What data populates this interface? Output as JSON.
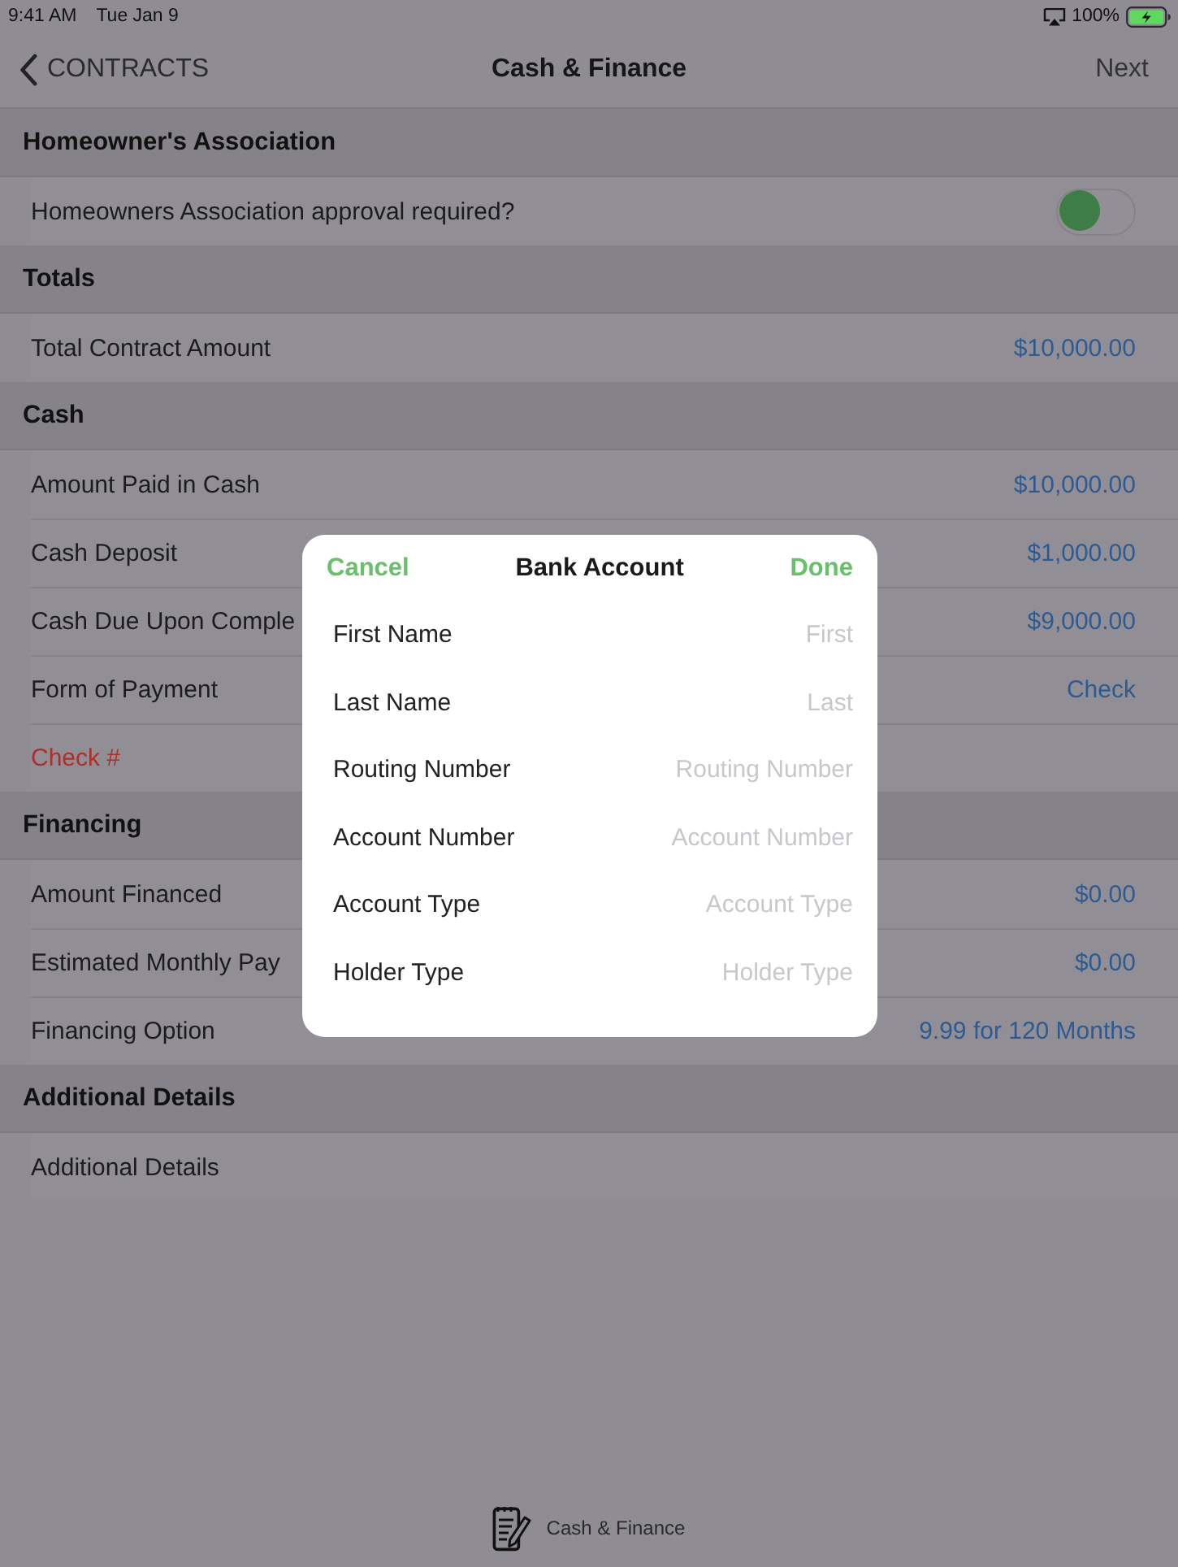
{
  "status_bar": {
    "time": "9:41 AM",
    "date": "Tue Jan 9",
    "battery": "100%"
  },
  "nav_bar": {
    "back": "CONTRACTS",
    "title": "Cash & Finance",
    "next": "Next"
  },
  "sections": [
    {
      "title": "Homeowner's Association",
      "rows": [
        {
          "kind": "toggle",
          "label": "Homeowners Association approval required?",
          "on": false
        }
      ]
    },
    {
      "title": "Totals",
      "rows": [
        {
          "kind": "value",
          "label": "Total Contract Amount",
          "value": "$10,000.00"
        }
      ]
    },
    {
      "title": "Cash",
      "rows": [
        {
          "kind": "value",
          "label": "Amount Paid in Cash",
          "value": "$10,000.00"
        },
        {
          "kind": "value",
          "label": "Cash Deposit",
          "value": "$1,000.00"
        },
        {
          "kind": "value",
          "label": "Cash Due Upon Comple",
          "value": "$9,000.00"
        },
        {
          "kind": "value",
          "label": "Form of Payment",
          "value": "Check"
        },
        {
          "kind": "required",
          "label": "Check #"
        }
      ]
    },
    {
      "title": "Financing",
      "rows": [
        {
          "kind": "value",
          "label": "Amount Financed",
          "value": "$0.00"
        },
        {
          "kind": "value",
          "label": "Estimated Monthly Pay",
          "value": "$0.00"
        },
        {
          "kind": "value",
          "label": "Financing Option",
          "value": "9.99 for 120 Months"
        }
      ]
    },
    {
      "title": "Additional Details",
      "rows": [
        {
          "kind": "text",
          "label": "Additional Details"
        }
      ]
    }
  ],
  "modal": {
    "cancel": "Cancel",
    "title": "Bank Account",
    "done": "Done",
    "fields": [
      {
        "label": "First Name",
        "placeholder": "First"
      },
      {
        "label": "Last Name",
        "placeholder": "Last"
      },
      {
        "label": "Routing Number",
        "placeholder": "Routing Number"
      },
      {
        "label": "Account Number",
        "placeholder": "Account Number"
      },
      {
        "label": "Account Type",
        "placeholder": "Account Type"
      },
      {
        "label": "Holder Type",
        "placeholder": "Holder Type"
      }
    ]
  },
  "tab_bar": {
    "label": "Cash & Finance"
  }
}
